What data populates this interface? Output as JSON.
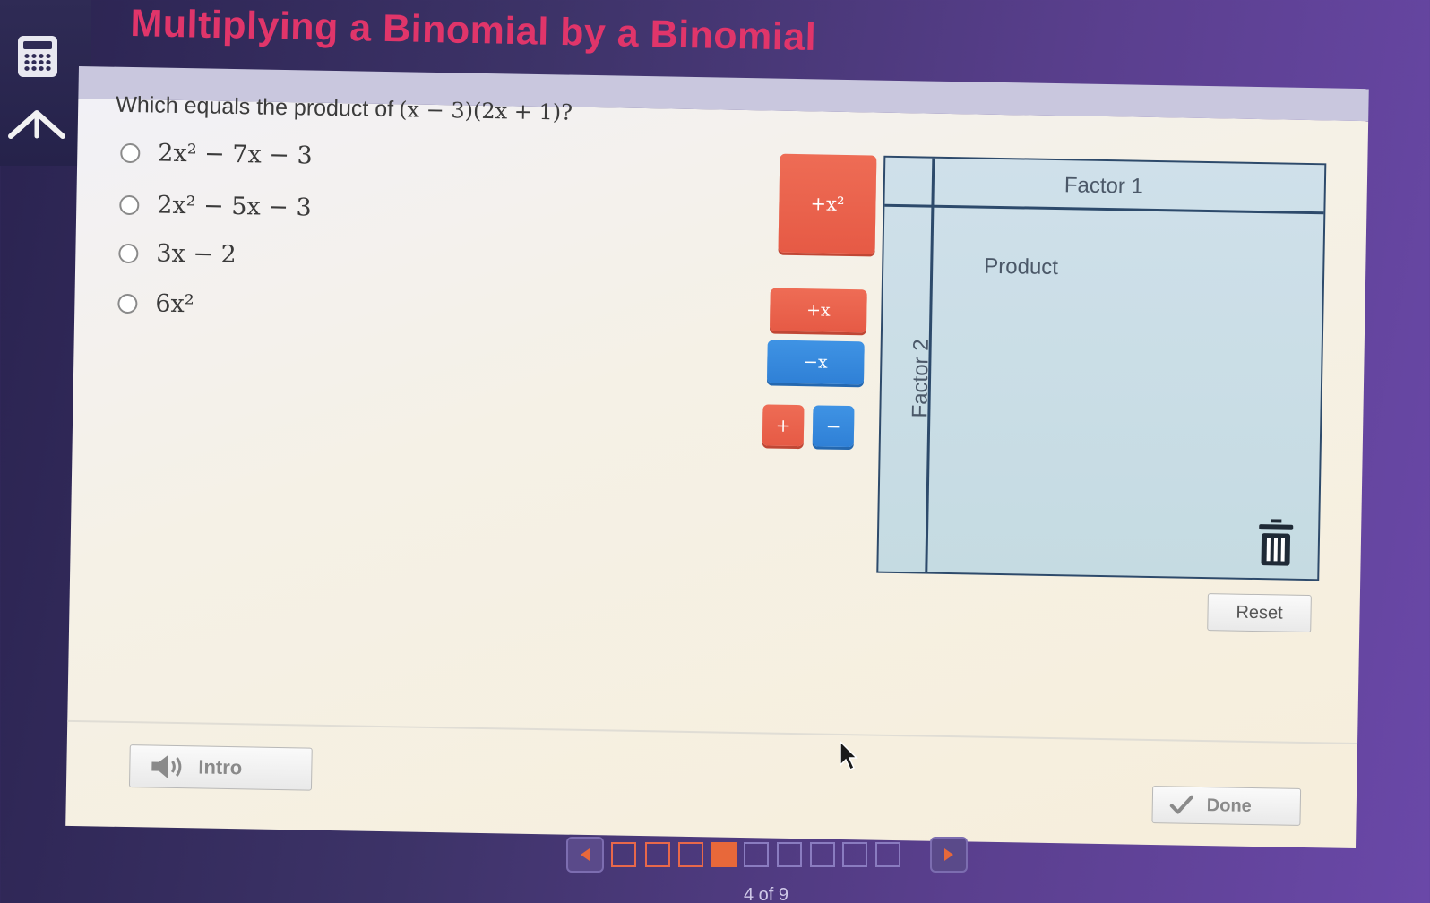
{
  "title": "Multiplying a Binomial by a Binomial",
  "question": {
    "prompt": "Which equals the product of",
    "expression": "(x − 3)(2x + 1)?"
  },
  "options": [
    {
      "label": "2x² − 7x − 3",
      "selected": false
    },
    {
      "label": "2x² − 5x − 3",
      "selected": false
    },
    {
      "label": "3x − 2",
      "selected": false
    },
    {
      "label": "6x²",
      "selected": false
    }
  ],
  "tiles": {
    "x_squared": "+x²",
    "x_positive": "+x",
    "x_negative": "−x",
    "unit_positive": "+",
    "unit_negative": "−"
  },
  "area_model": {
    "factor1_label": "Factor 1",
    "factor2_label": "Factor 2",
    "product_label": "Product"
  },
  "buttons": {
    "reset": "Reset",
    "intro": "Intro",
    "done": "Done"
  },
  "pager": {
    "label": "4 of 9",
    "current": 4,
    "total": 9
  },
  "colors": {
    "title": "#e0356a",
    "tile_positive": "#e65a45",
    "tile_negative": "#2f80d6",
    "pager_current": "#e8683a"
  }
}
